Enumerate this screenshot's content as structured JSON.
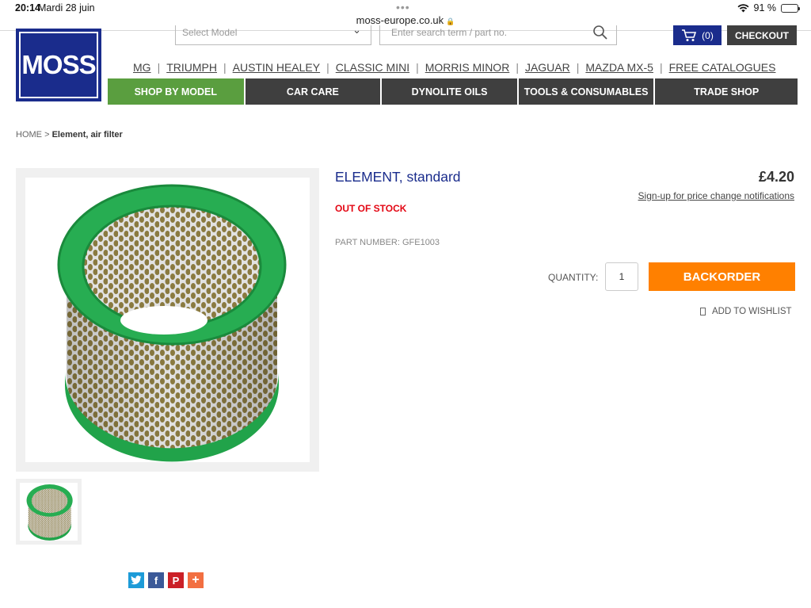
{
  "status": {
    "time": "20:14",
    "date": "Mardi 28 juin",
    "battery": "91 %",
    "battery_level": 0.91
  },
  "browser": {
    "url": "moss-europe.co.uk"
  },
  "header": {
    "logo_text": "MOSS",
    "model_select_placeholder": "Select Model",
    "search_placeholder": "Enter search term / part no.",
    "cart_count": "(0)",
    "checkout_label": "CHECKOUT"
  },
  "brands": [
    "MG",
    "TRIUMPH",
    "AUSTIN HEALEY",
    "CLASSIC MINI",
    "MORRIS MINOR",
    "JAGUAR",
    "MAZDA MX-5",
    "FREE CATALOGUES"
  ],
  "nav": [
    {
      "label": "SHOP BY MODEL",
      "active": true
    },
    {
      "label": "CAR CARE",
      "active": false
    },
    {
      "label": "DYNOLITE OILS",
      "active": false
    },
    {
      "label": "TOOLS & CONSUMABLES",
      "active": false
    },
    {
      "label": "TRADE SHOP",
      "active": false
    }
  ],
  "breadcrumb": {
    "home": "HOME",
    "sep": ">",
    "current": "Element, air filter"
  },
  "product": {
    "title": "ELEMENT, standard",
    "price": "£4.20",
    "notify_link": "Sign-up for price change notifications",
    "stock": "OUT OF STOCK",
    "part_number": "PART NUMBER: GFE1003",
    "quantity_label": "QUANTITY:",
    "quantity": "1",
    "backorder_label": "BACKORDER",
    "wishlist_label": "ADD TO WISHLIST"
  },
  "colors": {
    "brand_blue": "#1a2c8c",
    "active_green": "#5a9e3f",
    "nav_dark": "#3f3f3f",
    "backorder_orange": "#ff8000",
    "stock_red": "#e30613"
  },
  "social_icons": [
    "twitter-icon",
    "facebook-icon",
    "pinterest-icon",
    "share-plus-icon"
  ]
}
